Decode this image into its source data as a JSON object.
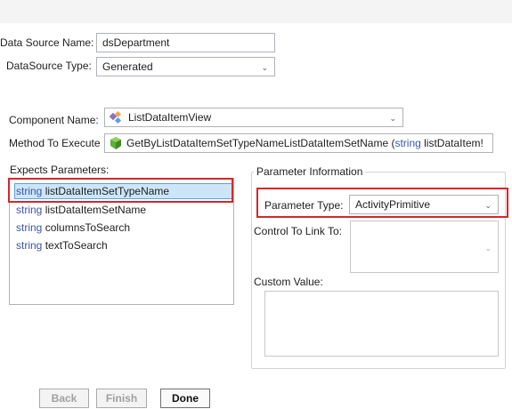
{
  "data_source": {
    "name_label": "Data Source Name:",
    "name_value": "dsDepartment",
    "type_label": "DataSource Type:",
    "type_value": "Generated"
  },
  "component": {
    "name_label": "Component Name:",
    "name_value": "ListDataItemView",
    "method_label": "Method To Execute",
    "method_value_prefix": "GetByListDataItemSetTypeNameListDataItemSetName (",
    "method_value_keyword": "string",
    "method_value_suffix": " listDataItem!"
  },
  "expects_parameters": {
    "label": "Expects Parameters:",
    "items": [
      {
        "type": "string",
        "name": "listDataItemSetTypeName",
        "selected": true
      },
      {
        "type": "string",
        "name": "listDataItemSetName"
      },
      {
        "type": "string",
        "name": "columnsToSearch"
      },
      {
        "type": "string",
        "name": "textToSearch"
      }
    ]
  },
  "parameter_info": {
    "title": "Parameter Information",
    "type_label": "Parameter Type:",
    "type_value": "ActivityPrimitive",
    "link_label": "Control To Link To:",
    "link_value": "",
    "custom_label": "Custom Value:",
    "custom_value": ""
  },
  "buttons": {
    "back": "Back",
    "finish": "Finish",
    "done": "Done"
  },
  "colors": {
    "highlight_border": "#d7262b",
    "selection_fill": "#cde6f7",
    "keyword": "#3a56a8"
  },
  "icons": {
    "component": "component-icon",
    "method": "method-cube-icon",
    "dropdown": "chevron-down-icon"
  }
}
